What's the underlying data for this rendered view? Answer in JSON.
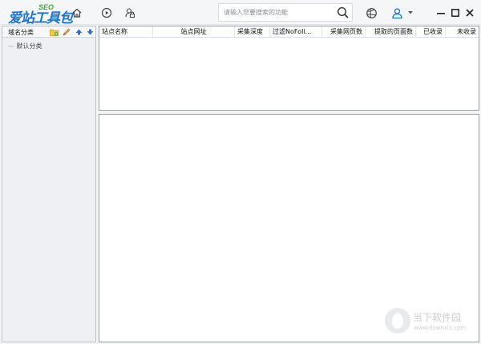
{
  "app": {
    "logo_text": "爱站工具包",
    "logo_badge": "SEO"
  },
  "toolbar": {
    "icons": [
      "home-icon",
      "play-circle-icon",
      "user-lock-icon",
      "globe-icon",
      "user-icon",
      "chevron-down-icon",
      "minimize-icon",
      "maximize-icon",
      "close-icon"
    ]
  },
  "search": {
    "placeholder": "请输入您要搜索的功能",
    "value": ""
  },
  "sidebar": {
    "title": "域名分类",
    "items": [
      {
        "label": "默认分类",
        "prefix": "—"
      }
    ],
    "actions": [
      "add-folder-icon",
      "edit-pencil-icon",
      "move-up-icon",
      "move-down-icon"
    ]
  },
  "table": {
    "columns": [
      "站点名称",
      "站点网址",
      "采集深度",
      "过滤NoFoll...",
      "采集网页数",
      "提取的页面数",
      "已收录",
      "未收录"
    ],
    "rows": []
  },
  "watermark": {
    "name": "当下软件园",
    "url": "www.downxia.com"
  },
  "colors": {
    "brand_blue": "#1a74d3",
    "brand_green": "#3fa83a",
    "panel_border": "#9aa0a6"
  }
}
